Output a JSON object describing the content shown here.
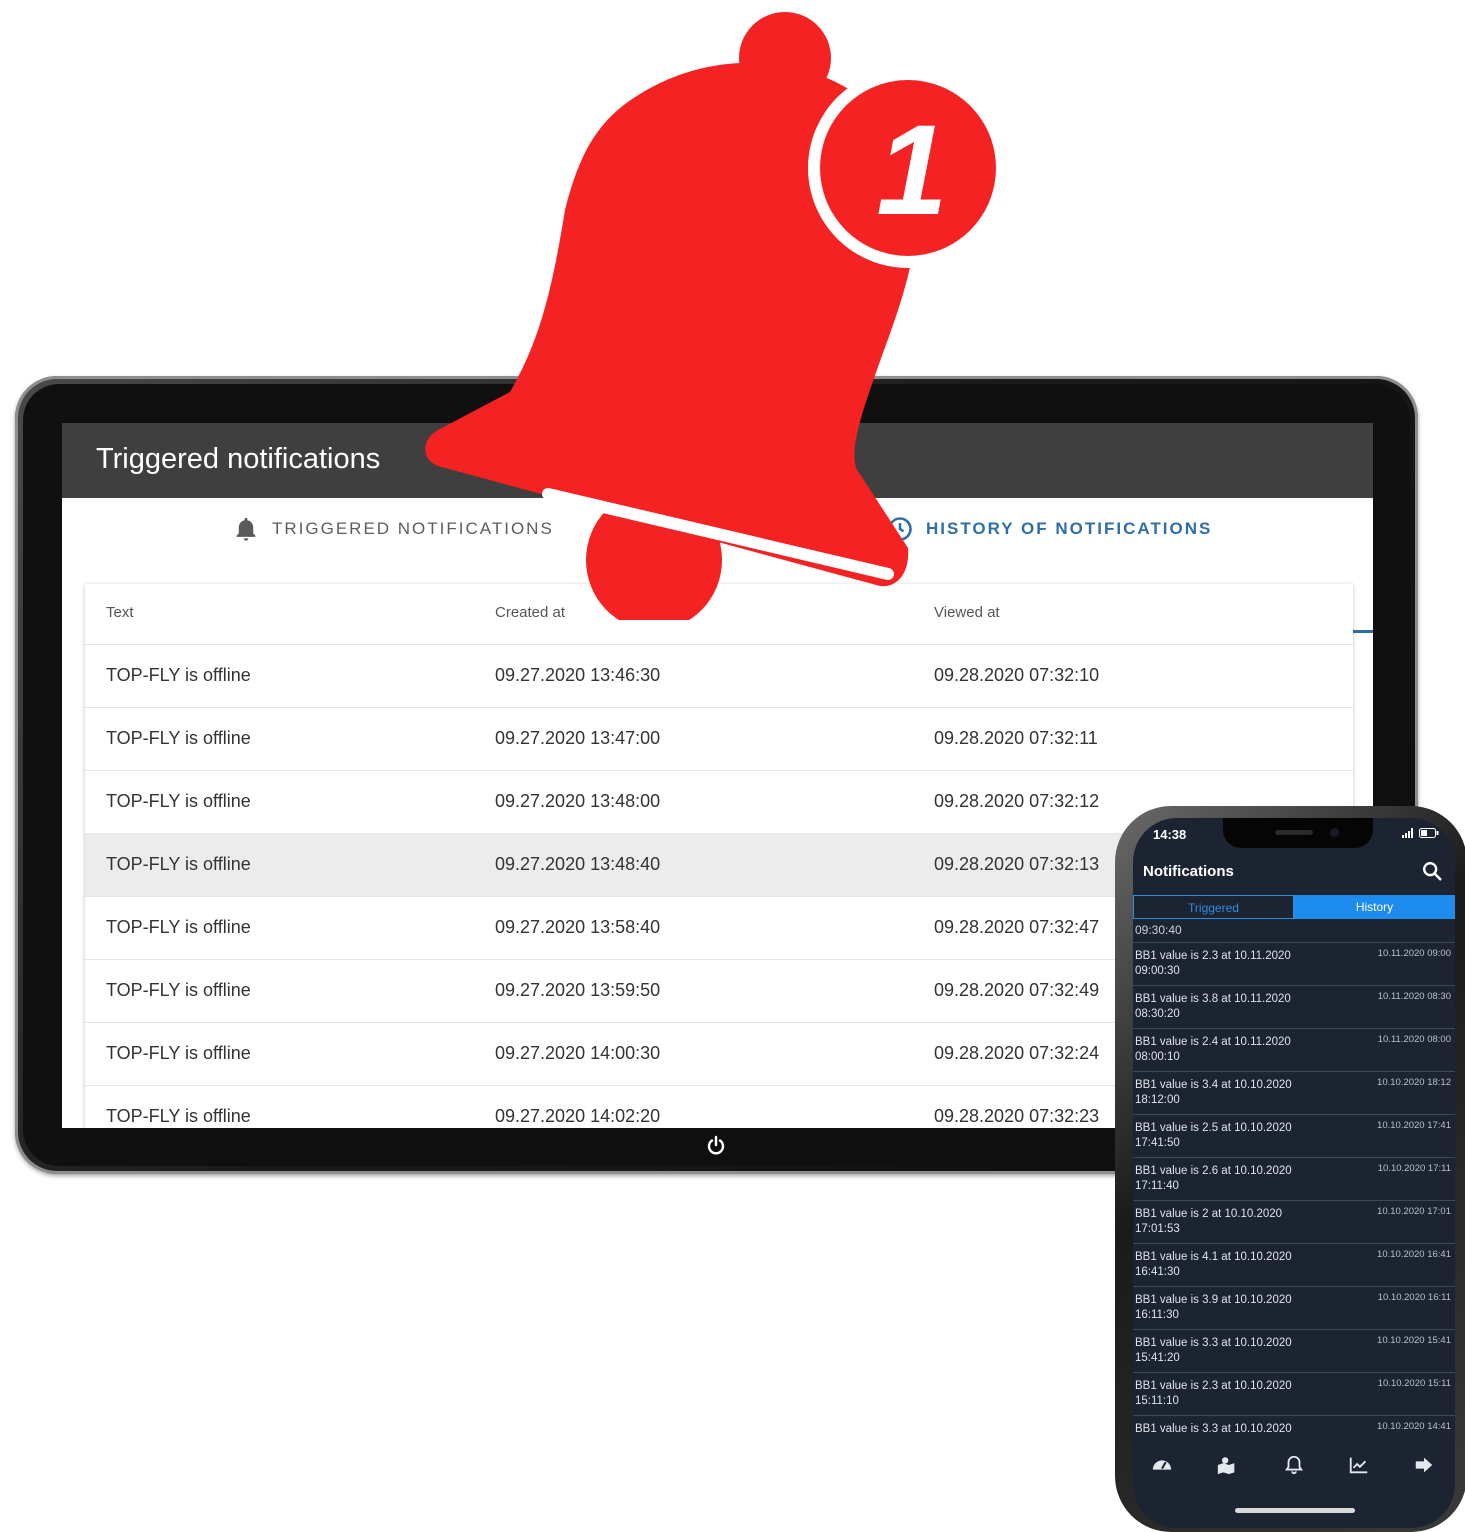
{
  "tablet": {
    "app_title": "Triggered notifications",
    "tabs": [
      {
        "label": "TRIGGERED NOTIFICATIONS",
        "icon": "bell-icon",
        "active": false
      },
      {
        "label": "HISTORY OF NOTIFICATIONS",
        "icon": "history-icon",
        "active": true
      }
    ],
    "table": {
      "headers": [
        "Text",
        "Created at",
        "Viewed at"
      ],
      "rows": [
        {
          "text": "TOP-FLY is offline",
          "created": "09.27.2020 13:46:30",
          "viewed": "09.28.2020 07:32:10"
        },
        {
          "text": "TOP-FLY is offline",
          "created": "09.27.2020 13:47:00",
          "viewed": "09.28.2020 07:32:11"
        },
        {
          "text": "TOP-FLY is offline",
          "created": "09.27.2020 13:48:00",
          "viewed": "09.28.2020 07:32:12"
        },
        {
          "text": "TOP-FLY is offline",
          "created": "09.27.2020 13:48:40",
          "viewed": "09.28.2020 07:32:13"
        },
        {
          "text": "TOP-FLY is offline",
          "created": "09.27.2020 13:58:40",
          "viewed": "09.28.2020 07:32:47"
        },
        {
          "text": "TOP-FLY is offline",
          "created": "09.27.2020 13:59:50",
          "viewed": "09.28.2020 07:32:49"
        },
        {
          "text": "TOP-FLY is offline",
          "created": "09.27.2020 14:00:30",
          "viewed": "09.28.2020 07:32:24"
        },
        {
          "text": "TOP-FLY is offline",
          "created": "09.27.2020 14:02:20",
          "viewed": "09.28.2020 07:32:23"
        }
      ]
    }
  },
  "bell": {
    "badge_count": "1",
    "color": "#f42222"
  },
  "phone": {
    "status_time": "14:38",
    "title": "Notifications",
    "tabs": [
      "Triggered",
      "History"
    ],
    "clipped_top": "09:30:40",
    "items": [
      {
        "line1": "BB1 value  is 2.3 at 10.11.2020",
        "line2": "09:00:30",
        "date": "10.11.2020 09:00"
      },
      {
        "line1": "BB1 value  is 3.8 at 10.11.2020",
        "line2": "08:30:20",
        "date": "10.11.2020 08:30"
      },
      {
        "line1": "BB1 value  is 2.4 at 10.11.2020",
        "line2": "08:00:10",
        "date": "10.11.2020 08:00"
      },
      {
        "line1": "BB1 value  is 3.4 at 10.10.2020",
        "line2": "18:12:00",
        "date": "10.10.2020 18:12"
      },
      {
        "line1": "BB1 value  is 2.5 at 10.10.2020",
        "line2": "17:41:50",
        "date": "10.10.2020 17:41"
      },
      {
        "line1": "BB1 value  is 2.6 at 10.10.2020",
        "line2": "17:11:40",
        "date": "10.10.2020 17:11"
      },
      {
        "line1": "BB1 value  is 2 at 10.10.2020",
        "line2": "17:01:53",
        "date": "10.10.2020 17:01"
      },
      {
        "line1": "BB1 value  is 4.1 at 10.10.2020",
        "line2": "16:41:30",
        "date": "10.10.2020 16:41"
      },
      {
        "line1": "BB1 value  is 3.9 at 10.10.2020",
        "line2": "16:11:30",
        "date": "10.10.2020 16:11"
      },
      {
        "line1": "BB1 value  is 3.3 at 10.10.2020",
        "line2": "15:41:20",
        "date": "10.10.2020 15:41"
      },
      {
        "line1": "BB1 value  is 2.3 at 10.10.2020",
        "line2": "15:11:10",
        "date": "10.10.2020 15:11"
      },
      {
        "line1": "BB1 value  is 3.3 at 10.10.2020",
        "line2": "",
        "date": "10.10.2020 14:41"
      }
    ],
    "nav_icons": [
      "dashboard-icon",
      "map-icon",
      "bell-icon",
      "chart-icon",
      "logout-icon"
    ]
  }
}
